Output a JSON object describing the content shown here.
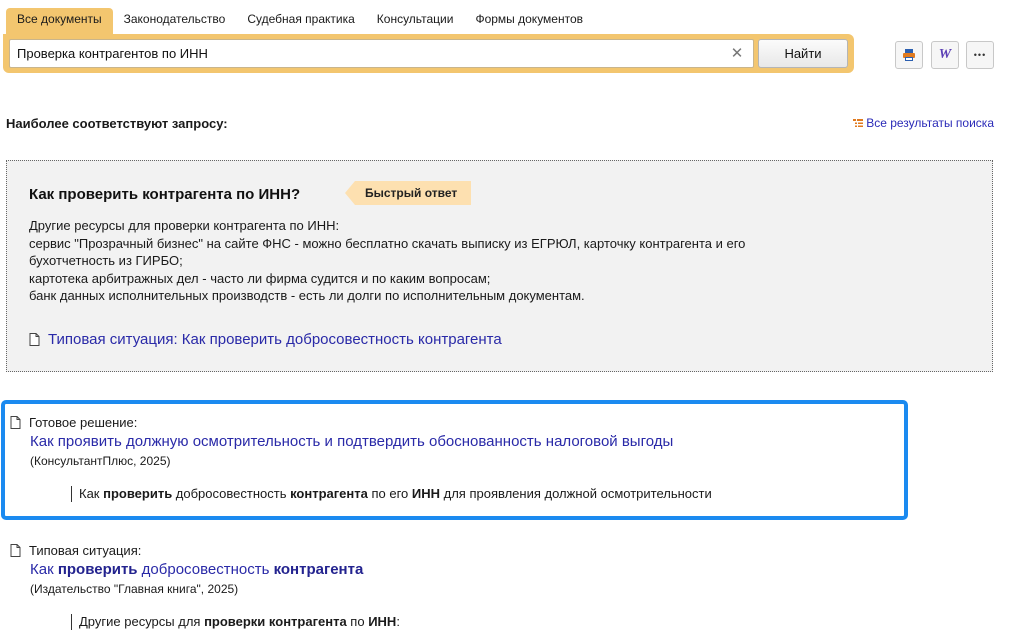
{
  "tabs": [
    "Все документы",
    "Законодательство",
    "Судебная практика",
    "Консультации",
    "Формы документов"
  ],
  "search": {
    "value": "Проверка контрагентов по ИНН",
    "find_label": "Найти"
  },
  "toolbar": {
    "word_label": "W",
    "more_label": "•••"
  },
  "best_heading": "Наиболее соответствуют запросу:",
  "all_results_label": "Все результаты поиска",
  "quick_answer": {
    "title": "Как проверить контрагента по ИНН?",
    "badge": "Быстрый ответ",
    "lines": [
      "Другие ресурсы для проверки контрагента по ИНН:",
      "сервис \"Прозрачный бизнес\" на сайте ФНС - можно бесплатно скачать выписку из ЕГРЮЛ, карточку контрагента и его",
      "бухотчетность из ГИРБО;",
      "картотека арбитражных дел - часто ли фирма судится и по каким вопросам;",
      "банк данных исполнительных производств - есть ли долги по исполнительным документам."
    ],
    "link": "Типовая ситуация: Как проверить добросовестность контрагента"
  },
  "results": [
    {
      "type": "Готовое решение:",
      "title": "Как проявить должную осмотрительность и подтвердить обоснованность налоговой выгоды",
      "source": "(КонсультантПлюс, 2025)",
      "snippet": [
        "Как ",
        "проверить",
        " добросовестность ",
        "контрагента",
        " по его ",
        "ИНН",
        " для проявления должной осмотрительности"
      ]
    },
    {
      "type": "Типовая ситуация:",
      "title": [
        "Как ",
        "проверить",
        " добросовестность ",
        "контрагента"
      ],
      "source": "(Издательство \"Главная книга\", 2025)",
      "snippet": [
        "Другие ресурсы для ",
        "проверки",
        " ",
        "контрагента",
        " по ",
        "ИНН",
        ":"
      ]
    }
  ]
}
